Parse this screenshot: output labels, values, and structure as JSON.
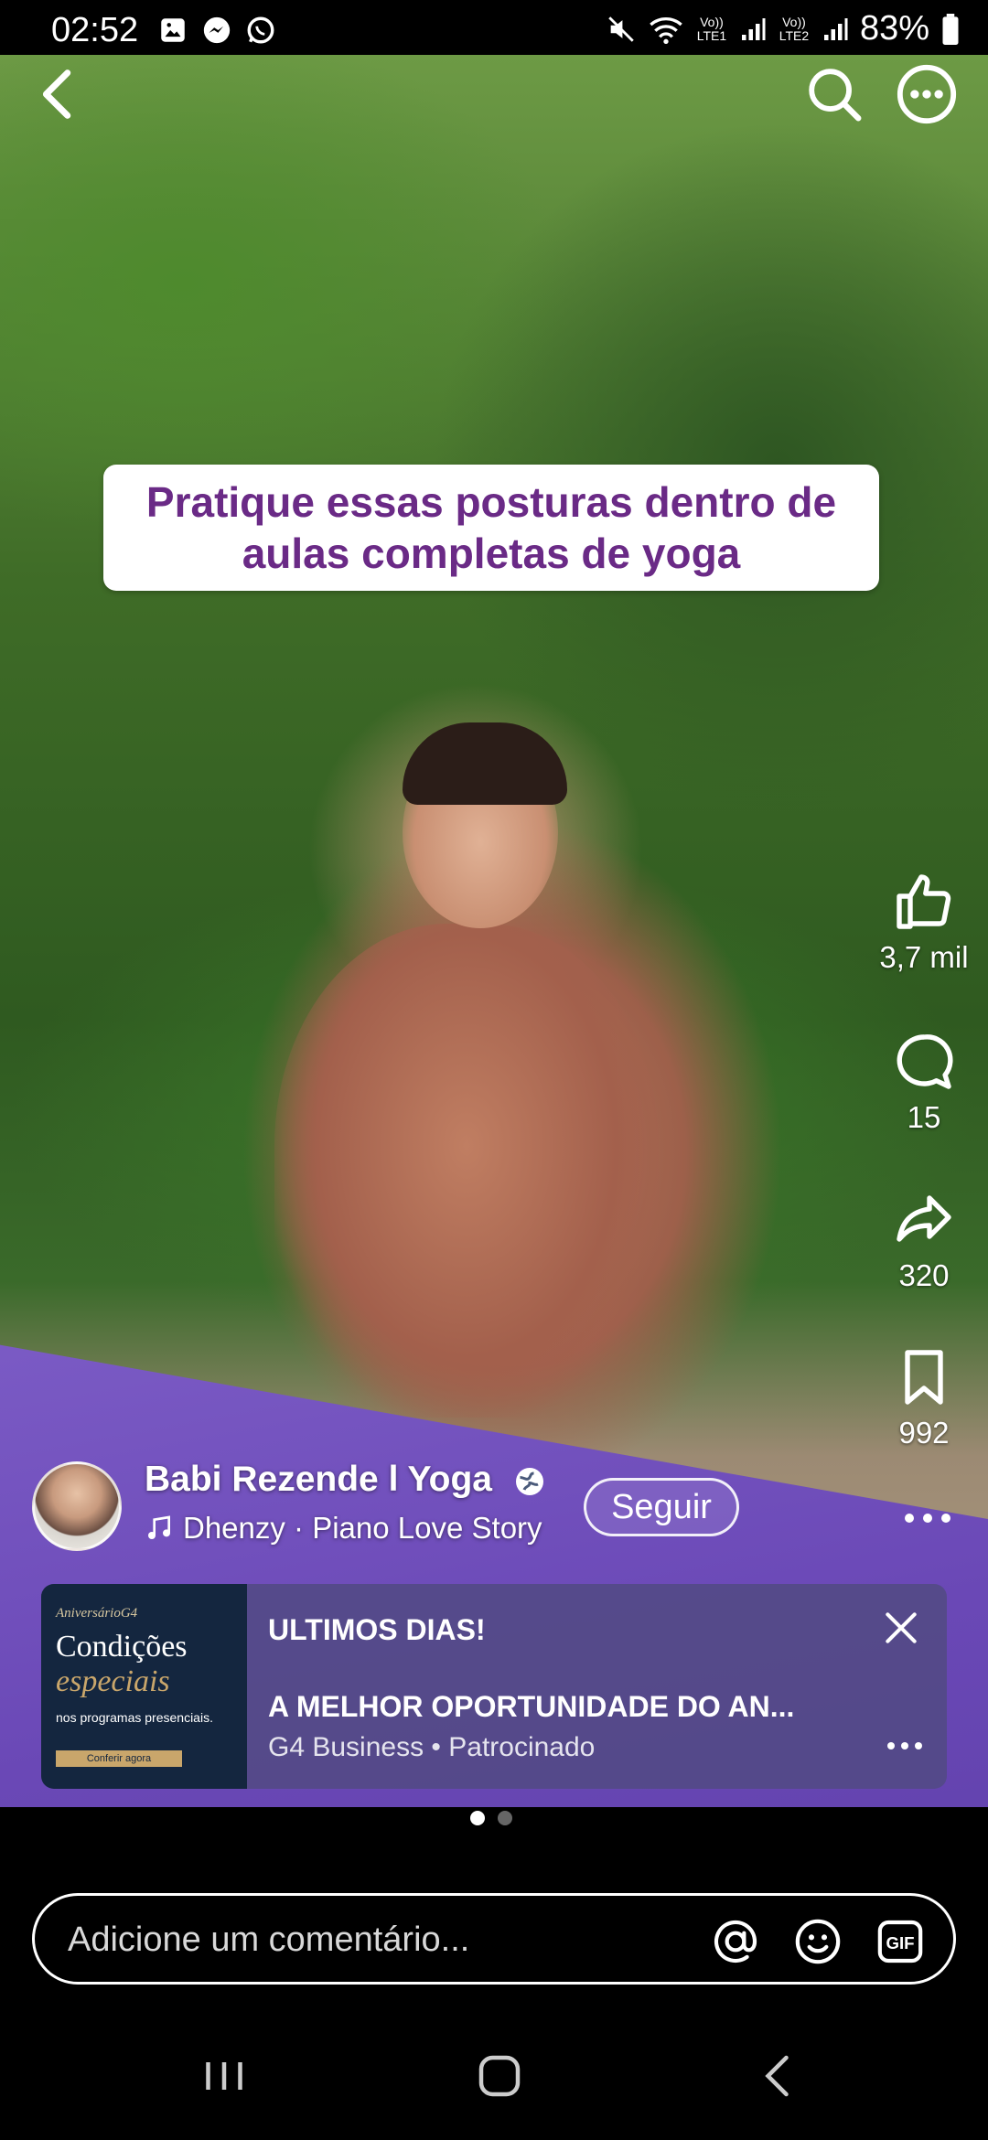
{
  "status_bar": {
    "time": "02:52",
    "notification_icons": [
      "gallery-icon",
      "messenger-icon",
      "whatsapp-icon"
    ],
    "sim1_label": "Vo)) LTE1",
    "sim2_label": "Vo)) LTE2",
    "battery_percent": "83%"
  },
  "video": {
    "caption": "Pratique essas posturas dentro de aulas completas de yoga"
  },
  "actions": {
    "likes": "3,7 mil",
    "comments": "15",
    "shares": "320",
    "saves": "992"
  },
  "author": {
    "name": "Babi Rezende l Yoga",
    "audio": "Dhenzy · Piano Love Story",
    "follow_label": "Seguir"
  },
  "ad": {
    "image_small": "AniversárioG4",
    "image_line1": "Condições",
    "image_line2": "especiais",
    "image_sub": "nos programas presenciais.",
    "image_cta": "Conferir agora",
    "title": "ULTIMOS DIAS!",
    "headline": "A MELHOR OPORTUNIDADE DO AN...",
    "advertiser": "G4 Business",
    "sponsored_label": "Patrocinado",
    "meta": "G4 Business • Patrocinado"
  },
  "pager": {
    "count": 2,
    "active": 0
  },
  "comment_bar": {
    "placeholder": "Adicione um comentário..."
  },
  "colors": {
    "caption_text": "#6a2a86",
    "ad_background": "#524a84",
    "mat": "#6a48b6"
  }
}
